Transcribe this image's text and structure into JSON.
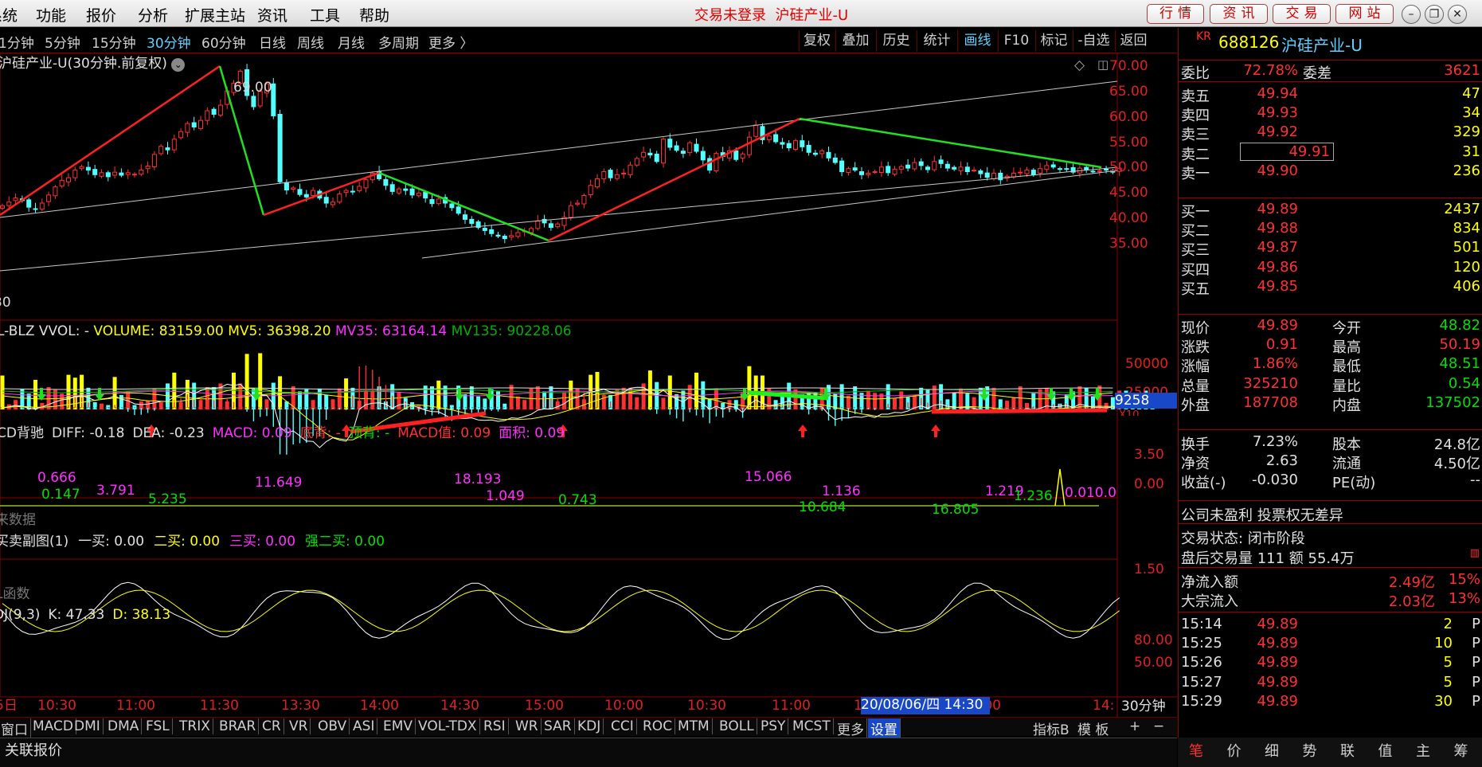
{
  "menubar": {
    "items": [
      "系统",
      "功能",
      "报价",
      "分析",
      "扩展主站",
      "资讯",
      "工具",
      "帮助"
    ],
    "status": "交易未登录",
    "stock_title": "沪硅产业-U",
    "buttons": [
      "行情",
      "资讯",
      "交易",
      "网站"
    ]
  },
  "periods": {
    "items": [
      "1分钟",
      "5分钟",
      "15分钟",
      "30分钟",
      "60分钟",
      "日线",
      "周线",
      "月线",
      "多周期",
      "更多 〉"
    ],
    "active": "30分钟"
  },
  "toolbar": {
    "items": [
      "复权",
      "叠加",
      "历史",
      "统计",
      "画线",
      "F10",
      "标记",
      "-自选",
      "返回"
    ],
    "active": "画线"
  },
  "main_chart": {
    "title": "沪硅产业-U(30分钟.前复权)",
    "peak_label": "69.00",
    "low_label": "30",
    "y_ticks": [
      "70.00",
      "65.00",
      "60.00",
      "55.00",
      "50.00",
      "45.00",
      "40.00",
      "35.00"
    ]
  },
  "volume": {
    "title": "L-BLZ VVOL: -",
    "items": [
      {
        "label": "VOLUME: 83159.00",
        "color": "#ffff00"
      },
      {
        "label": "MV5: 36398.20",
        "color": "#ffff00"
      },
      {
        "label": "MV35: 63164.14",
        "color": "#ff30ff"
      },
      {
        "label": "MV135: 90228.06",
        "color": "#00b000"
      }
    ],
    "y_ticks": [
      "50000",
      "25000"
    ],
    "current": "9258",
    "unit": "X10"
  },
  "macd": {
    "items": [
      {
        "label": "CD背驰",
        "color": "#e0e0e0"
      },
      {
        "label": "DIFF: -0.18",
        "color": "#e0e0e0"
      },
      {
        "label": "DEA: -0.23",
        "color": "#e0e0e0"
      },
      {
        "label": "MACD: 0.09",
        "color": "#ff30ff"
      },
      {
        "label": "底背: -",
        "color": "#ff3030"
      },
      {
        "label": "顶背: -",
        "color": "#00e000"
      },
      {
        "label": "MACD值: 0.09",
        "color": "#ff3030"
      },
      {
        "label": "面积: 0.09",
        "color": "#ff30ff"
      }
    ],
    "y_ticks": [
      "3.50",
      "0.00"
    ],
    "note": "来数据",
    "annotations": [
      {
        "text": "0.666",
        "color": "#ff30ff"
      },
      {
        "text": "0.147",
        "color": "#00e000"
      },
      {
        "text": "3.791",
        "color": "#ff30ff"
      },
      {
        "text": "5.235",
        "color": "#00e000"
      },
      {
        "text": "11.649",
        "color": "#ff30ff"
      },
      {
        "text": "18.193",
        "color": "#ff30ff"
      },
      {
        "text": "1.049",
        "color": "#ff30ff"
      },
      {
        "text": "0.743",
        "color": "#00e000"
      },
      {
        "text": "15.066",
        "color": "#ff30ff"
      },
      {
        "text": "1.136",
        "color": "#ff30ff"
      },
      {
        "text": "10.684",
        "color": "#00e000"
      },
      {
        "text": "16.805",
        "color": "#00e000"
      },
      {
        "text": "1.219",
        "color": "#ff30ff"
      },
      {
        "text": "1.236",
        "color": "#00e000"
      },
      {
        "text": "0.010.0",
        "color": "#ff30ff"
      }
    ]
  },
  "buysell": {
    "items": [
      {
        "label": "买卖副图(1)",
        "color": "#e0e0e0"
      },
      {
        "label": "一买: 0.00",
        "color": "#e0e0e0"
      },
      {
        "label": "二买: 0.00",
        "color": "#ffff00"
      },
      {
        "label": "三买: 0.00",
        "color": "#ff30ff"
      },
      {
        "label": "强二买: 0.00",
        "color": "#00e000"
      }
    ],
    "y_tick": "1.50",
    "note": "L函数"
  },
  "kdj": {
    "items": [
      {
        "label": "DJ(9,3)",
        "color": "#e0e0e0"
      },
      {
        "label": "K: 47.33",
        "color": "#e0e0e0"
      },
      {
        "label": "D: 38.13",
        "color": "#ffff00"
      }
    ],
    "y_ticks": [
      "80.00",
      "50.00"
    ]
  },
  "time_axis": {
    "labels": [
      "5日",
      "10:30",
      "11:00",
      "11:30",
      "13:30",
      "14:00",
      "14:30",
      "15:00",
      "10:00",
      "10:30",
      "11:00",
      "1",
      "14:00",
      "14:"
    ],
    "cursor": "20/08/06/四 14:30",
    "period": "30分钟"
  },
  "bottom_tabs": {
    "items": [
      "窗口",
      "MACD",
      "DMI",
      "DMA",
      "FSL",
      "TRIX",
      "BRAR",
      "CR",
      "VR",
      "OBV",
      "ASI",
      "EMV",
      "VOL-TDX",
      "RSI",
      "WR",
      "SAR",
      "KDJ",
      "CCI",
      "ROC",
      "MTM",
      "BOLL",
      "PSY",
      "MCST",
      "更多",
      "设置"
    ],
    "active": "设置",
    "right": [
      "指标B",
      "模 板",
      "+",
      "−"
    ]
  },
  "footer": {
    "label": "关联报价"
  },
  "quote": {
    "market": "KR",
    "code": "688126",
    "name": "沪硅产业-U",
    "weibi_label": "委比",
    "weibi": "72.78%",
    "weicha_label": "委差",
    "weicha": "3621",
    "asks": [
      {
        "label": "卖五",
        "price": "49.94",
        "vol": "47"
      },
      {
        "label": "卖四",
        "price": "49.93",
        "vol": "34"
      },
      {
        "label": "卖三",
        "price": "49.92",
        "vol": "329"
      },
      {
        "label": "卖二",
        "price": "49.91",
        "vol": "31"
      },
      {
        "label": "卖一",
        "price": "49.90",
        "vol": "236"
      }
    ],
    "bids": [
      {
        "label": "买一",
        "price": "49.89",
        "vol": "2437"
      },
      {
        "label": "买二",
        "price": "49.88",
        "vol": "834"
      },
      {
        "label": "买三",
        "price": "49.87",
        "vol": "501"
      },
      {
        "label": "买四",
        "price": "49.86",
        "vol": "120"
      },
      {
        "label": "买五",
        "price": "49.85",
        "vol": "406"
      }
    ],
    "stats": [
      {
        "l1": "现价",
        "v1": "49.89",
        "l2": "今开",
        "v2": "48.82"
      },
      {
        "l1": "涨跌",
        "v1": "0.91",
        "l2": "最高",
        "v2": "50.19"
      },
      {
        "l1": "涨幅",
        "v1": "1.86%",
        "l2": "最低",
        "v2": "48.51"
      },
      {
        "l1": "总量",
        "v1": "325210",
        "l2": "量比",
        "v2": "0.54"
      },
      {
        "l1": "外盘",
        "v1": "187708",
        "l2": "内盘",
        "v2": "137502"
      }
    ],
    "stats2": [
      {
        "l1": "换手",
        "v1": "7.23%",
        "l2": "股本",
        "v2": "24.8亿"
      },
      {
        "l1": "净资",
        "v1": "2.63",
        "l2": "流通",
        "v2": "4.50亿"
      },
      {
        "l1": "收益(-)",
        "v1": "-0.030",
        "l2": "PE(动)",
        "v2": "--"
      }
    ],
    "notice": "公司未盈利 投票权无差异",
    "trade_status": "交易状态: 闭市阶段",
    "after_hours": "盘后交易量 111 额 55.4万",
    "flows": [
      {
        "label": "净流入额",
        "value": "2.49亿",
        "pct": "15%"
      },
      {
        "label": "大宗流入",
        "value": "2.03亿",
        "pct": "13%"
      }
    ],
    "ticks": [
      {
        "time": "15:14",
        "price": "49.89",
        "vol": "2",
        "flag": "P"
      },
      {
        "time": "15:25",
        "price": "49.89",
        "vol": "10",
        "flag": "P"
      },
      {
        "time": "15:26",
        "price": "49.89",
        "vol": "5",
        "flag": "P"
      },
      {
        "time": "15:27",
        "price": "49.89",
        "vol": "5",
        "flag": "P"
      },
      {
        "time": "15:29",
        "price": "49.89",
        "vol": "30",
        "flag": "P"
      }
    ],
    "bottom_tabs": [
      "笔",
      "价",
      "细",
      "势",
      "联",
      "值",
      "主",
      "筹"
    ]
  },
  "chart_data": [
    {
      "type": "candlestick",
      "title": "沪硅产业-U(30分钟.前复权)",
      "ylim": [
        33,
        72
      ],
      "y_ticks": [
        35,
        40,
        45,
        50,
        55,
        60,
        65,
        70
      ],
      "close": [
        42.5,
        43.2,
        44.0,
        43.5,
        42.2,
        41.8,
        43.0,
        44.6,
        46.2,
        47.5,
        48.0,
        49.5,
        50.2,
        49.5,
        48.6,
        49.0,
        48.2,
        49.1,
        48.5,
        49.0,
        48.7,
        49.5,
        50.3,
        52.6,
        54.2,
        53.5,
        55.6,
        57.1,
        58.7,
        58.0,
        59.3,
        61.2,
        60.5,
        62.3,
        65.1,
        66.6,
        69.0,
        64.2,
        62.0,
        65.0,
        66.5,
        60.2,
        47.2,
        45.6,
        46.0,
        44.7,
        44.2,
        45.5,
        44.0,
        43.0,
        43.2,
        44.8,
        45.5,
        45.3,
        46.3,
        47.6,
        48.9,
        47.8,
        46.5,
        45.3,
        45.8,
        45.5,
        44.6,
        45.0,
        44.0,
        42.9,
        43.8,
        43.0,
        42.1,
        41.0,
        39.8,
        39.0,
        38.2,
        37.6,
        37.0,
        36.5,
        36.0,
        36.6,
        37.2,
        37.5,
        38.0,
        39.5,
        39.1,
        38.2,
        38.9,
        40.2,
        42.5,
        43.0,
        44.5,
        46.5,
        47.8,
        49.2,
        48.0,
        48.6,
        48.9,
        50.5,
        51.8,
        53.0,
        52.5,
        51.2,
        55.6,
        54.0,
        53.4,
        52.8,
        54.9,
        53.2,
        51.5,
        49.5,
        52.8,
        52.2,
        53.3,
        51.6,
        52.7,
        56.0,
        58.4,
        55.5,
        56.2,
        55.1,
        54.6,
        53.9,
        55.3,
        54.1,
        53.0,
        52.6,
        53.3,
        51.9,
        51.0,
        49.2,
        49.8,
        49.5,
        48.6,
        48.9,
        49.2,
        50.1,
        49.0,
        49.7,
        50.2,
        49.9,
        51.0,
        50.4,
        49.6,
        51.2,
        50.8,
        49.9,
        49.7,
        50.1,
        49.2,
        49.5,
        48.8,
        48.1,
        48.9,
        47.6,
        48.3,
        48.9,
        49.1,
        49.5,
        48.6,
        49.8,
        50.4,
        50.1,
        49.8,
        49.7,
        49.1,
        49.9,
        49.6,
        49.3,
        49.4,
        49.5,
        49.1,
        49.89
      ]
    },
    {
      "type": "bar",
      "title": "VOLUME",
      "ylim": [
        0,
        100000
      ],
      "y_ticks": [
        25000,
        50000
      ],
      "values": [
        47000,
        7000,
        13000,
        28000,
        22000,
        41000,
        9000,
        31000,
        27000,
        22000,
        48000,
        44000,
        48000,
        30000,
        10000,
        8000,
        6000,
        45000,
        20000,
        25000,
        6000,
        11000,
        12000,
        29000,
        10000,
        36000,
        51000,
        10000,
        41000,
        37000,
        13000,
        31000,
        31000,
        36000,
        11000,
        51000,
        36000,
        77000,
        28000,
        78000,
        14000,
        37000,
        46000,
        11000,
        32000,
        25000,
        28000,
        13000,
        29000,
        20000,
        14000,
        29000,
        43000,
        30000,
        12000,
        26000,
        25000,
        32000,
        11000,
        35000,
        24000,
        16000,
        10000,
        5000,
        33000,
        32000,
        40000,
        33000,
        6000,
        33000,
        21000,
        32000,
        18000,
        15000,
        28000,
        25000,
        8000,
        34000,
        18000,
        13000,
        29000,
        32000,
        25000,
        32000,
        11000,
        24000,
        40000,
        29000,
        14000,
        48000,
        52000,
        20000,
        20000,
        27000,
        30000,
        30000,
        17000,
        36000,
        54000,
        38000,
        16000,
        47000,
        21000,
        26000,
        34000,
        51000,
        39000,
        15000,
        29000,
        9000,
        13000,
        13000,
        24000,
        60000,
        47000,
        47000,
        29000,
        13000,
        24000,
        37000,
        28000,
        21000,
        23000,
        23000,
        30000,
        34000,
        22000,
        35000,
        19000,
        32000,
        23000,
        26000,
        23000,
        22000,
        35000,
        15000,
        25000,
        17000,
        20000,
        30000,
        27000,
        33000,
        35000,
        14000,
        23000,
        29000,
        22000,
        17000,
        30000,
        32000,
        30000,
        14000,
        12000,
        16000,
        32000,
        9000,
        23000,
        28000,
        30000,
        25000,
        8000,
        21000,
        25000,
        32000,
        30000,
        18000,
        33000,
        9000,
        17000,
        26000,
        26000,
        18000,
        18000,
        26000,
        8000
      ],
      "current": 9258
    }
  ]
}
